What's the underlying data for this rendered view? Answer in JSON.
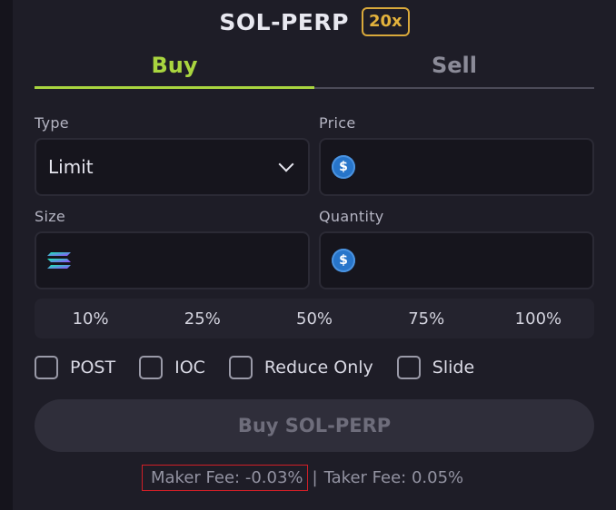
{
  "header": {
    "market": "SOL-PERP",
    "leverage": "20x"
  },
  "tabs": [
    {
      "label": "Buy",
      "active": true
    },
    {
      "label": "Sell",
      "active": false
    }
  ],
  "form": {
    "type_label": "Type",
    "type_value": "Limit",
    "price_label": "Price",
    "size_label": "Size",
    "quantity_label": "Quantity",
    "usdc_symbol": "$"
  },
  "percentages": [
    "10%",
    "25%",
    "50%",
    "75%",
    "100%"
  ],
  "options": [
    {
      "label": "POST",
      "checked": false
    },
    {
      "label": "IOC",
      "checked": false
    },
    {
      "label": "Reduce Only",
      "checked": false
    },
    {
      "label": "Slide",
      "checked": false
    }
  ],
  "submit_label": "Buy SOL-PERP",
  "fees": {
    "maker": "Maker Fee: -0.03%",
    "separator": "|",
    "taker": "Taker Fee: 0.05%"
  },
  "colors": {
    "buy_accent": "#a9d53f",
    "leverage_accent": "#e3b23c",
    "usdc": "#2775ca",
    "highlight_border": "#d01f27"
  },
  "icons": {
    "price": "usdc-icon",
    "size": "solana-icon",
    "quantity": "usdc-icon",
    "type": "chevron-down-icon"
  }
}
